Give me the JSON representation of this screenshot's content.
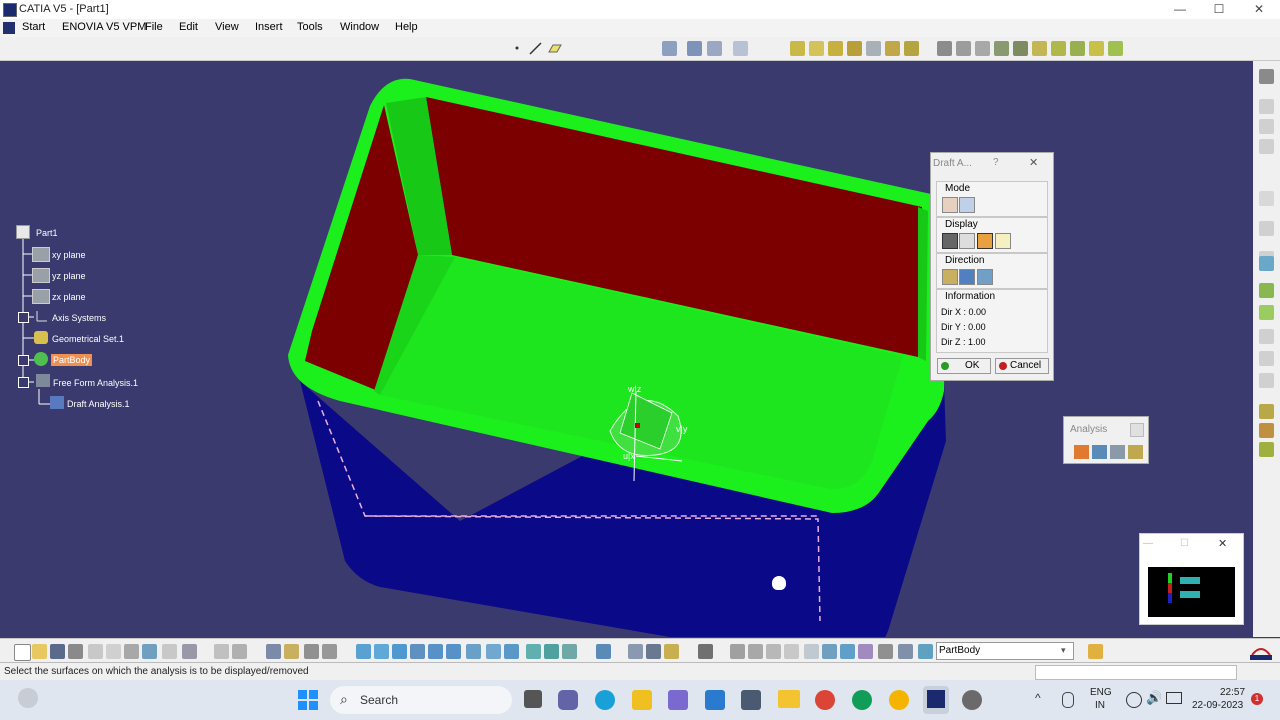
{
  "window": {
    "title": "CATIA V5 - [Part1]",
    "controls": {
      "minimize": "—",
      "maximize": "☐",
      "close": "✕"
    }
  },
  "menu": {
    "items": [
      "Start",
      "ENOVIA V5 VPM",
      "File",
      "Edit",
      "View",
      "Insert",
      "Tools",
      "Window",
      "Help"
    ]
  },
  "tree": {
    "root": "Part1",
    "items": [
      {
        "label": "xy plane"
      },
      {
        "label": "yz plane"
      },
      {
        "label": "zx plane"
      },
      {
        "label": "Axis Systems"
      },
      {
        "label": "Geometrical Set.1"
      },
      {
        "label": "PartBody"
      },
      {
        "label": "Free Form Analysis.1"
      },
      {
        "label": "Draft Analysis.1"
      }
    ]
  },
  "compass": {
    "w_z": "w|z",
    "v_y": "v|y",
    "u_x": "u|x"
  },
  "draft_dialog": {
    "title": "Draft A...",
    "help": "?",
    "close": "✕",
    "mode_label": "Mode",
    "display_label": "Display",
    "direction_label": "Direction",
    "information_label": "Information",
    "dir_x": "Dir X : 0.00",
    "dir_y": "Dir Y : 0.00",
    "dir_z": "Dir Z : 1.00",
    "ok": "OK",
    "cancel": "Cancel"
  },
  "analysis_toolbar": {
    "title": "Analysis"
  },
  "mini_window": {
    "close": "✕",
    "max": "☐",
    "min": "—"
  },
  "bottom": {
    "current_body": "PartBody"
  },
  "status": {
    "message": "Select the surfaces on which the analysis is to be displayed/removed"
  },
  "taskbar": {
    "search": "Search",
    "lang1": "ENG",
    "lang2": "IN",
    "time": "22:57",
    "date": "22-09-2023",
    "notif": "1"
  },
  "colors": {
    "background": "#3a3a6e",
    "shell_green": "#1cf01c",
    "floor_green": "#1ee61e",
    "wall_red": "#7c0000",
    "outer_blue": "#0a0a88"
  }
}
